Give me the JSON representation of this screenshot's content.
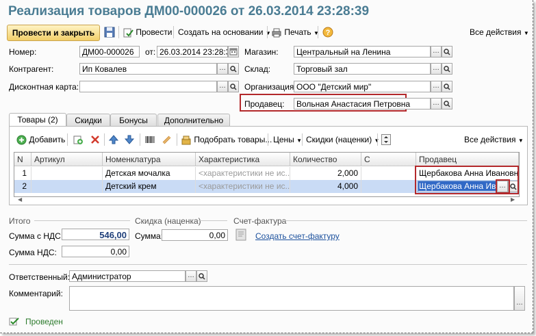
{
  "window": {
    "title": "Реализация товаров ДМ00-000026 от 26.03.2014 23:28:39"
  },
  "toolbar": {
    "post_close": "Провести и закрыть",
    "post": "Провести",
    "create_basis": "Создать на основании",
    "print": "Печать",
    "all_actions": "Все действия"
  },
  "header": {
    "number_label": "Номер:",
    "number_value": "ДМ00-000026",
    "date_label": "от:",
    "date_value": "26.03.2014 23:28:39",
    "store_label": "Магазин:",
    "store_value": "Центральный на Ленина",
    "counterparty_label": "Контрагент:",
    "counterparty_value": "Ип Ковалев",
    "warehouse_label": "Склад:",
    "warehouse_value": "Торговый зал",
    "discount_card_label": "Дисконтная карта:",
    "discount_card_value": "",
    "organization_label": "Организация:",
    "organization_value": "ООО \"Детский мир\"",
    "seller_label": "Продавец:",
    "seller_value": "Вольная Анастасия Петровна"
  },
  "tabs": [
    {
      "label": "Товары (2)"
    },
    {
      "label": "Скидки"
    },
    {
      "label": "Бонусы"
    },
    {
      "label": "Дополнительно"
    }
  ],
  "goods_toolbar": {
    "add": "Добавить",
    "pick": "Подобрать товары...",
    "prices": "Цены",
    "discounts": "Скидки (наценки)",
    "all_actions": "Все действия"
  },
  "table": {
    "columns": [
      "N",
      "Артикул",
      "Номенклатура",
      "Характеристика",
      "Количество",
      "С",
      "Продавец"
    ],
    "rows": [
      {
        "n": "1",
        "article": "",
        "nomenclature": "Детская мочалка",
        "characteristic": "<характеристики не ис...",
        "quantity": "2,000",
        "seller": "Щербакова Анна Ивановна"
      },
      {
        "n": "2",
        "article": "",
        "nomenclature": "Детский крем",
        "characteristic": "<характеристики не ис...",
        "quantity": "4,000",
        "seller": "Щербакова Анна Иван"
      }
    ]
  },
  "totals": {
    "section_label": "Итого",
    "sum_vat_label": "Сумма с НДС:",
    "sum_vat_value": "546,00",
    "vat_label": "Сумма НДС:",
    "vat_value": "0,00"
  },
  "discount": {
    "section_label": "Скидка (наценка)",
    "sum_label": "Сумма:",
    "sum_value": "0,00"
  },
  "invoice": {
    "section_label": "Счет-фактура",
    "create_link": "Создать счет-фактуру"
  },
  "footer": {
    "responsible_label": "Ответственный:",
    "responsible_value": "Администратор",
    "comment_label": "Комментарий:",
    "comment_value": "",
    "status": "Проведен"
  },
  "colors": {
    "title": "#4a7c93",
    "highlight": "#b3282b",
    "link": "#1a4f9c",
    "selection": "#c9dbf5"
  }
}
